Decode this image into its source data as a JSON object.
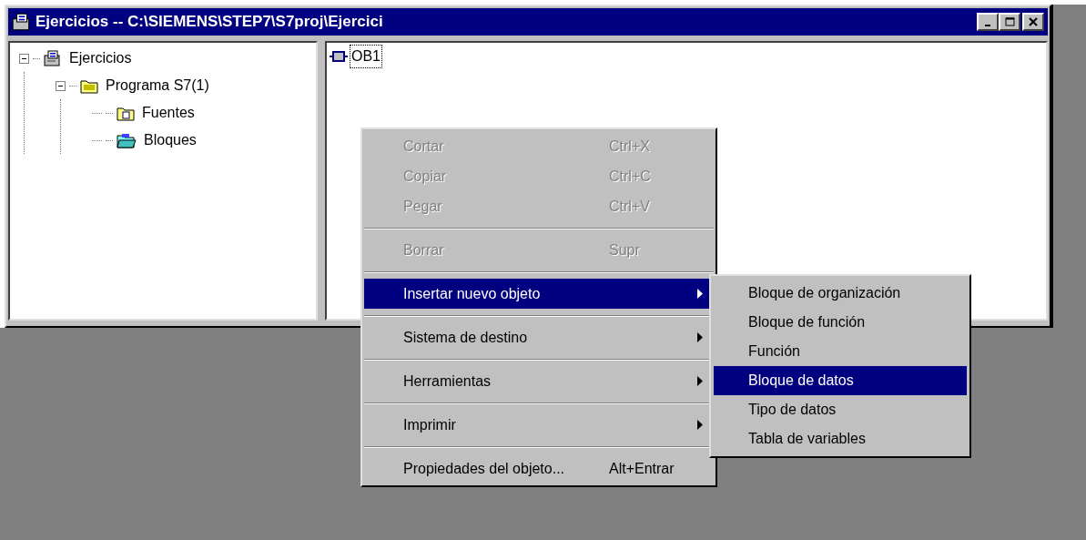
{
  "window": {
    "title": "Ejercicios -- C:\\SIEMENS\\STEP7\\S7proj\\Ejercici"
  },
  "tree": [
    {
      "label": "Ejercicios",
      "kind": "project",
      "expanded": true,
      "children": [
        {
          "label": "Programa S7(1)",
          "kind": "program",
          "expanded": true,
          "children": [
            {
              "label": "Fuentes",
              "kind": "sources"
            },
            {
              "label": "Bloques",
              "kind": "blocks"
            }
          ]
        }
      ]
    }
  ],
  "objects": [
    {
      "label": "OB1",
      "selected": true
    }
  ],
  "context_menu": {
    "groups": [
      [
        {
          "label": "Cortar",
          "shortcut": "Ctrl+X",
          "disabled": true,
          "selected": false,
          "submenu": false
        },
        {
          "label": "Copiar",
          "shortcut": "Ctrl+C",
          "disabled": true,
          "selected": false,
          "submenu": false
        },
        {
          "label": "Pegar",
          "shortcut": "Ctrl+V",
          "disabled": true,
          "selected": false,
          "submenu": false
        }
      ],
      [
        {
          "label": "Borrar",
          "shortcut": "Supr",
          "disabled": true,
          "selected": false,
          "submenu": false
        }
      ],
      [
        {
          "label": "Insertar nuevo objeto",
          "disabled": false,
          "selected": true,
          "submenu": true
        }
      ],
      [
        {
          "label": "Sistema de destino",
          "disabled": false,
          "selected": false,
          "submenu": true
        }
      ],
      [
        {
          "label": "Herramientas",
          "disabled": false,
          "selected": false,
          "submenu": true
        }
      ],
      [
        {
          "label": "Imprimir",
          "disabled": false,
          "selected": false,
          "submenu": true
        }
      ],
      [
        {
          "label": "Propiedades del objeto...",
          "shortcut": "Alt+Entrar",
          "disabled": false,
          "selected": false,
          "submenu": false
        }
      ]
    ]
  },
  "submenu": [
    {
      "label": "Bloque de organización",
      "selected": false
    },
    {
      "label": "Bloque de función",
      "selected": false
    },
    {
      "label": "Función",
      "selected": false
    },
    {
      "label": "Bloque de datos",
      "selected": true
    },
    {
      "label": "Tipo de datos",
      "selected": false
    },
    {
      "label": "Tabla de variables",
      "selected": false
    }
  ]
}
